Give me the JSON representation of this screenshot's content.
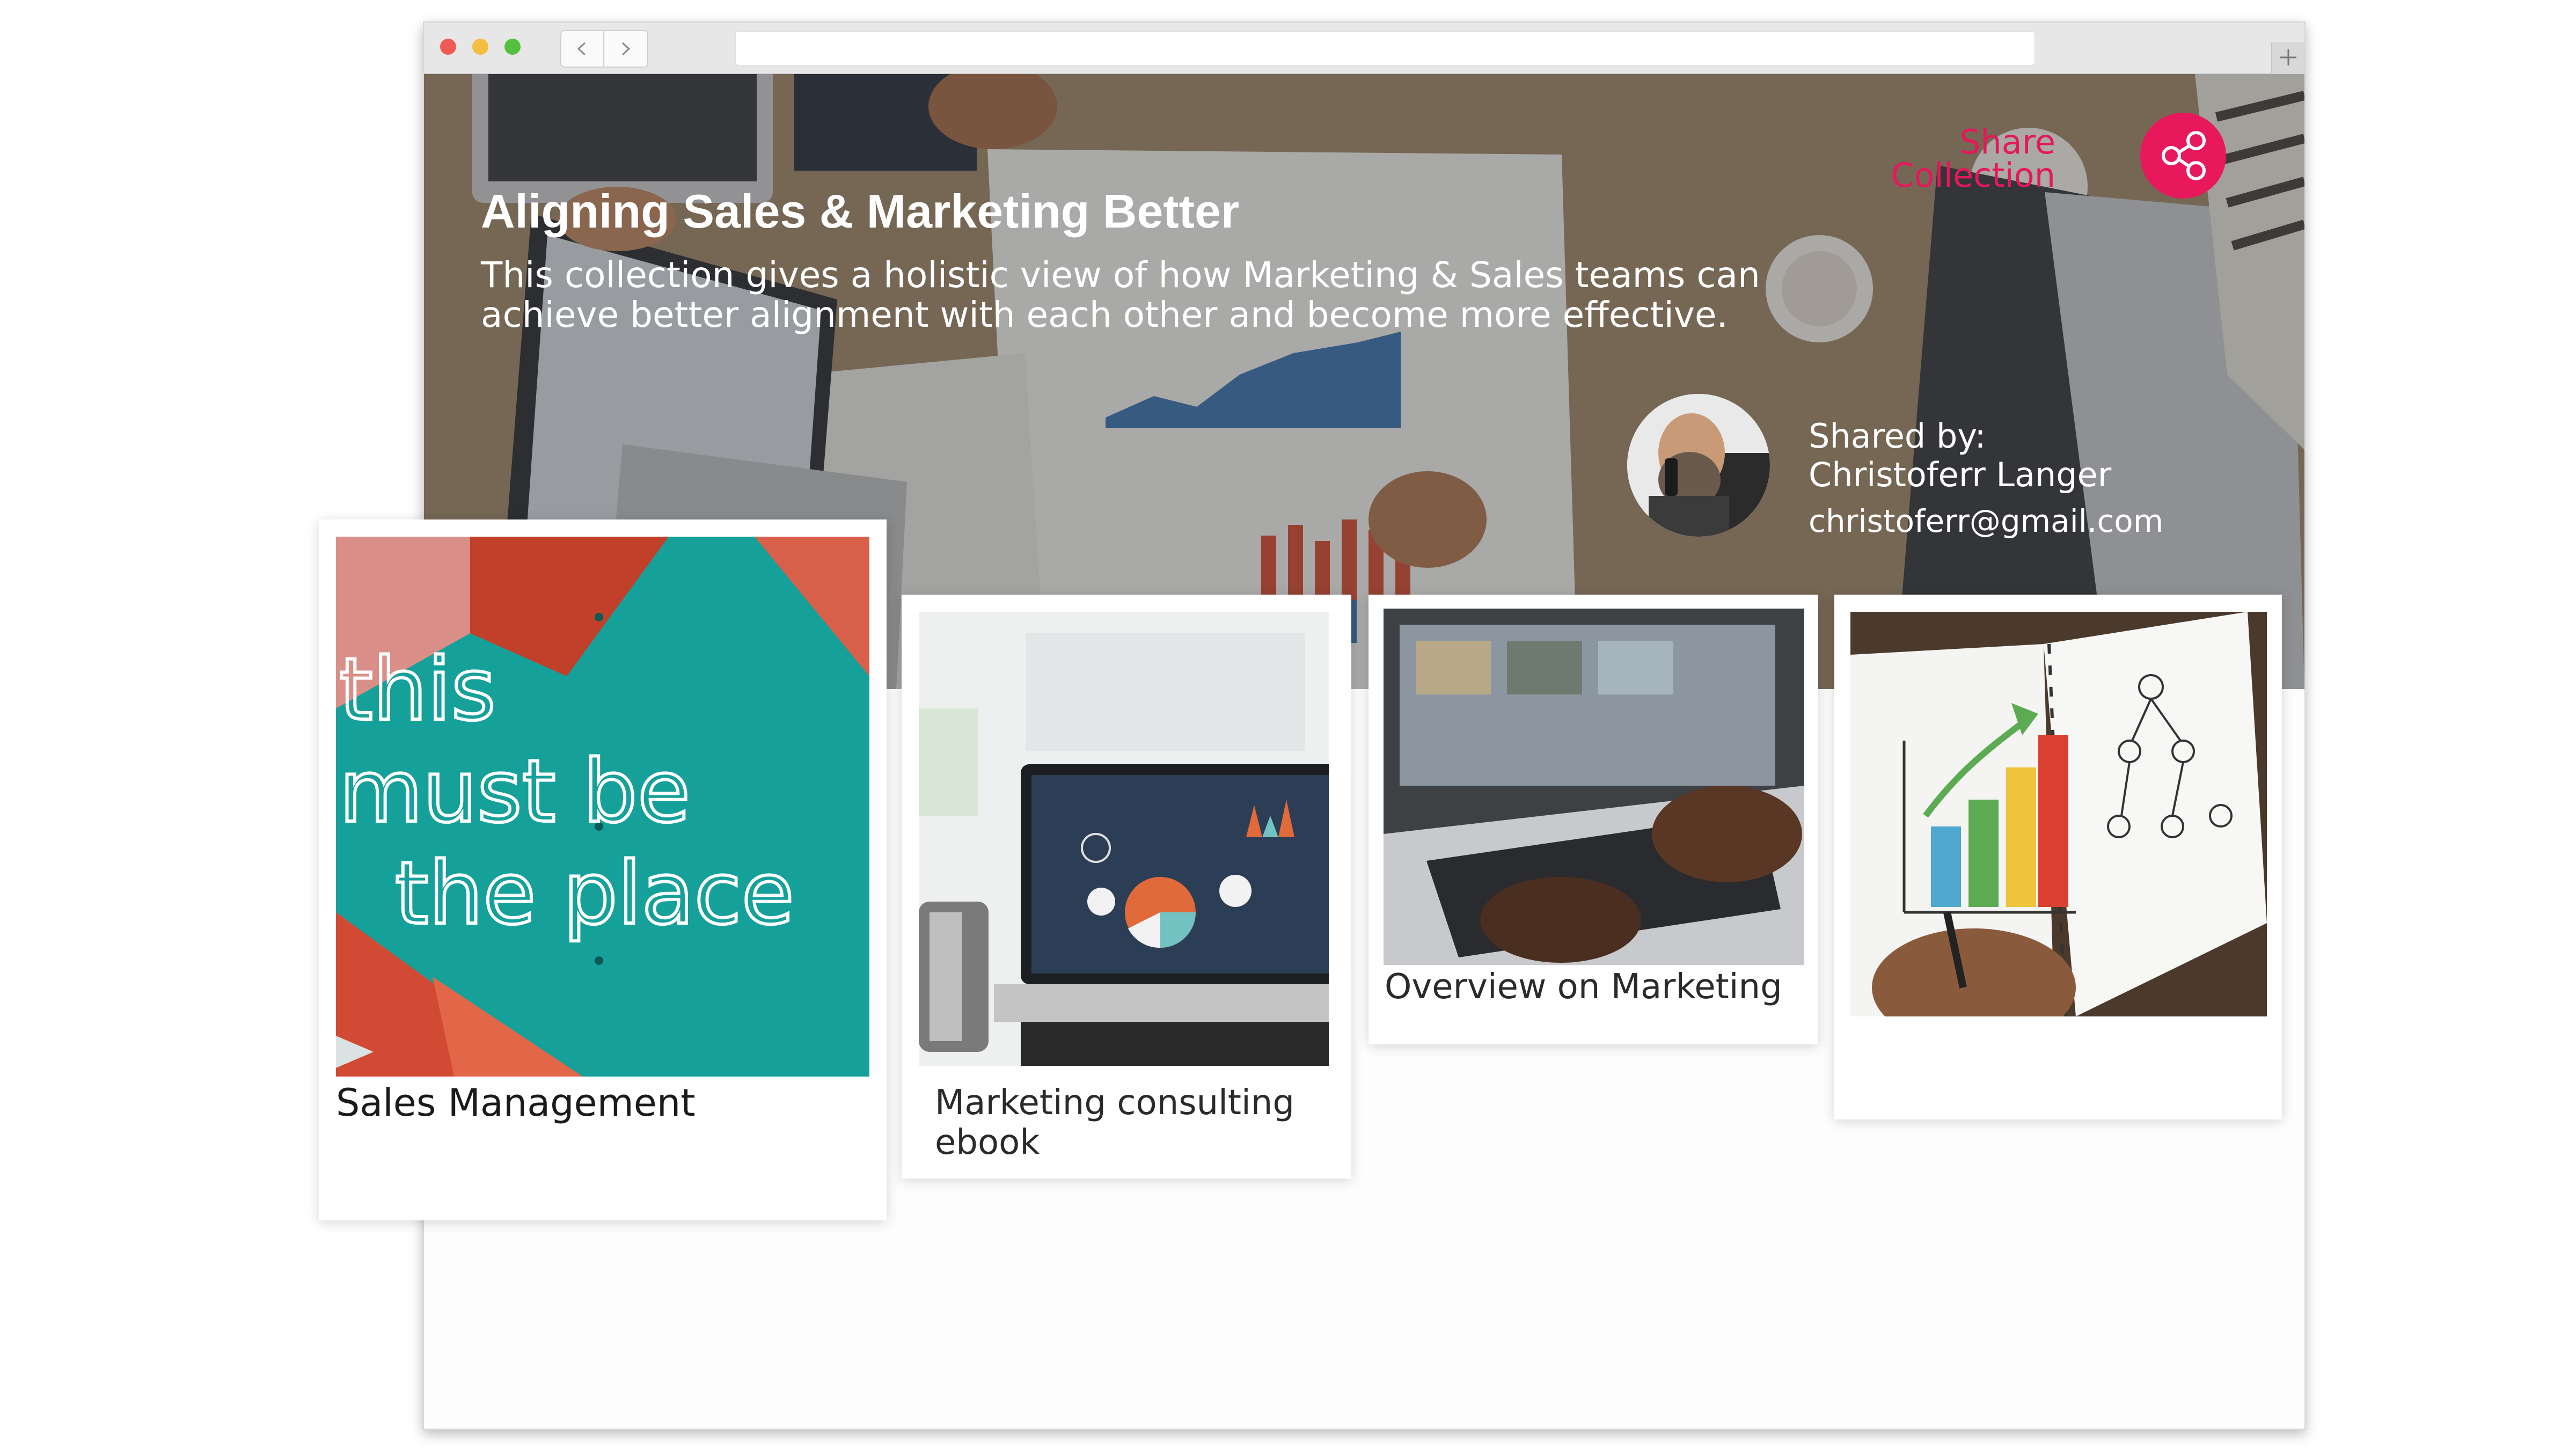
{
  "browser": {
    "back_glyph": "<",
    "forward_glyph": ">",
    "new_tab_glyph": "+",
    "address": ""
  },
  "collection": {
    "title": "Aligning Sales & Marketing Better",
    "description": "This collection gives a holistic view of how Marketing & Sales teams can achieve better alignment with each other and become more effective."
  },
  "share": {
    "label": "Share Collection",
    "icon": "share-icon",
    "color": "#e8185c"
  },
  "owner": {
    "label": "Shared by:",
    "name": "Christoferr Langer",
    "email": "christoferr@gmail.com"
  },
  "cards": [
    {
      "title": "Sales Management",
      "image": "neon-sign-image",
      "neon_text": [
        "this",
        "must be",
        "the place"
      ]
    },
    {
      "title": "Marketing consulting ebook",
      "image": "laptop-analytics-image"
    },
    {
      "title": "Overview on Marketing",
      "image": "laptop-typing-image"
    },
    {
      "title": "",
      "image": "notebook-chart-image"
    }
  ]
}
